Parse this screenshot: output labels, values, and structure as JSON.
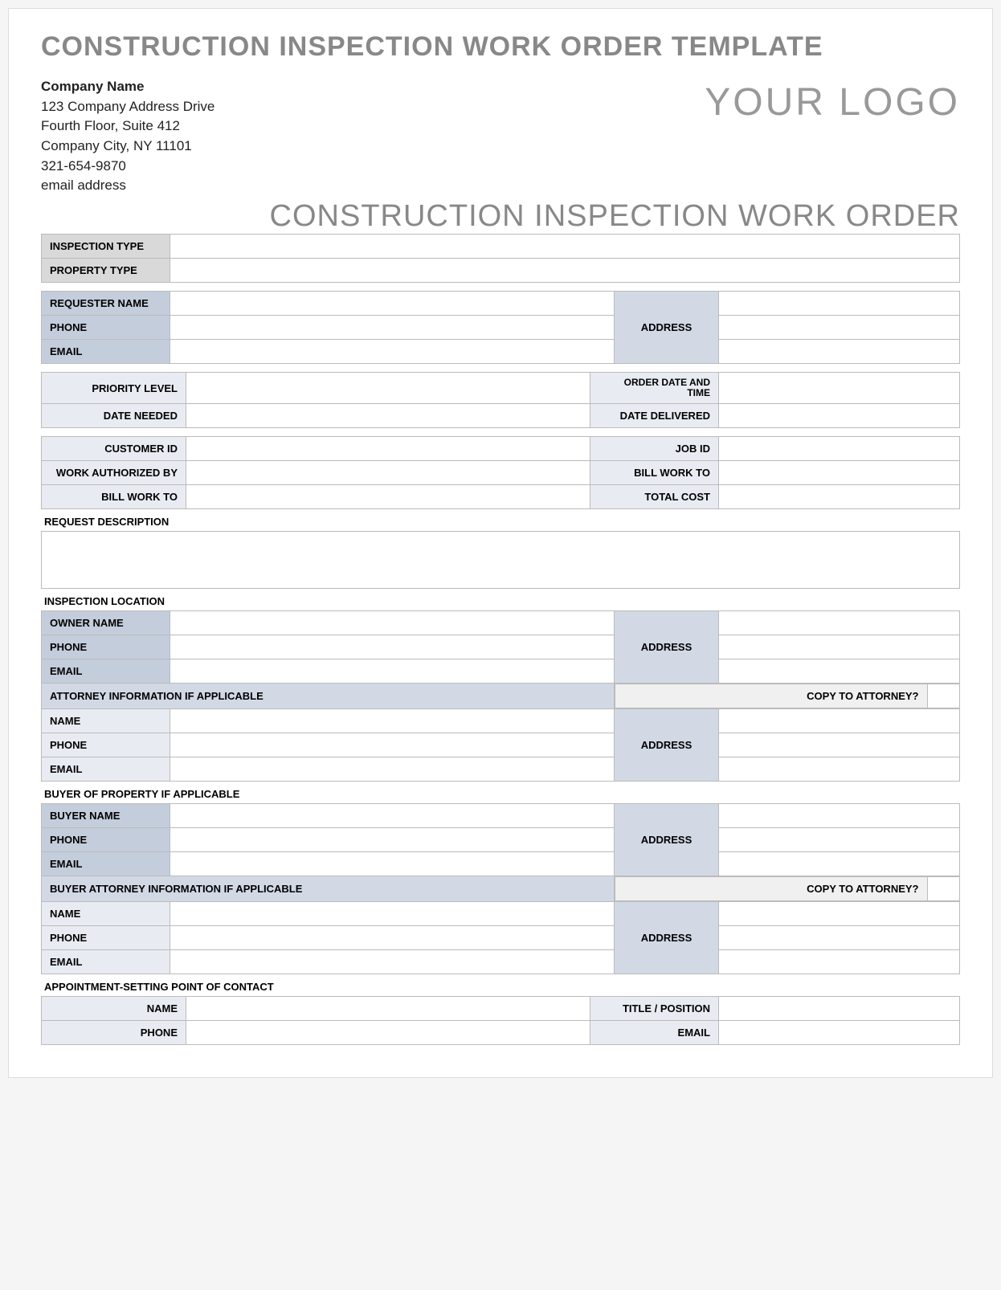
{
  "docTitle": "CONSTRUCTION INSPECTION WORK ORDER TEMPLATE",
  "company": {
    "name": "Company Name",
    "addr1": "123 Company Address Drive",
    "addr2": "Fourth Floor, Suite 412",
    "addr3": "Company City, NY  11101",
    "phone": "321-654-9870",
    "email": "email address"
  },
  "logoText": "YOUR LOGO",
  "formTitle": "CONSTRUCTION INSPECTION WORK ORDER",
  "labels": {
    "inspectionType": "INSPECTION TYPE",
    "propertyType": "PROPERTY TYPE",
    "requesterName": "REQUESTER NAME",
    "phone": "PHONE",
    "email": "EMAIL",
    "address": "ADDRESS",
    "priorityLevel": "PRIORITY LEVEL",
    "orderDateTime": "ORDER DATE AND TIME",
    "dateNeeded": "DATE NEEDED",
    "dateDelivered": "DATE DELIVERED",
    "customerId": "CUSTOMER ID",
    "jobId": "JOB ID",
    "workAuthBy": "WORK AUTHORIZED BY",
    "billWorkTo": "BILL WORK TO",
    "totalCost": "TOTAL COST",
    "requestDesc": "REQUEST DESCRIPTION",
    "inspectionLocation": "INSPECTION LOCATION",
    "ownerName": "OWNER NAME",
    "attorneyInfo": "ATTORNEY INFORMATION IF APPLICABLE",
    "copyToAttorney": "COPY TO ATTORNEY?",
    "name": "NAME",
    "buyerSection": "BUYER OF PROPERTY IF APPLICABLE",
    "buyerName": "BUYER NAME",
    "buyerAttorneyInfo": "BUYER ATTORNEY INFORMATION IF APPLICABLE",
    "appointmentSection": "APPOINTMENT-SETTING POINT OF CONTACT",
    "titlePosition": "TITLE / POSITION"
  }
}
